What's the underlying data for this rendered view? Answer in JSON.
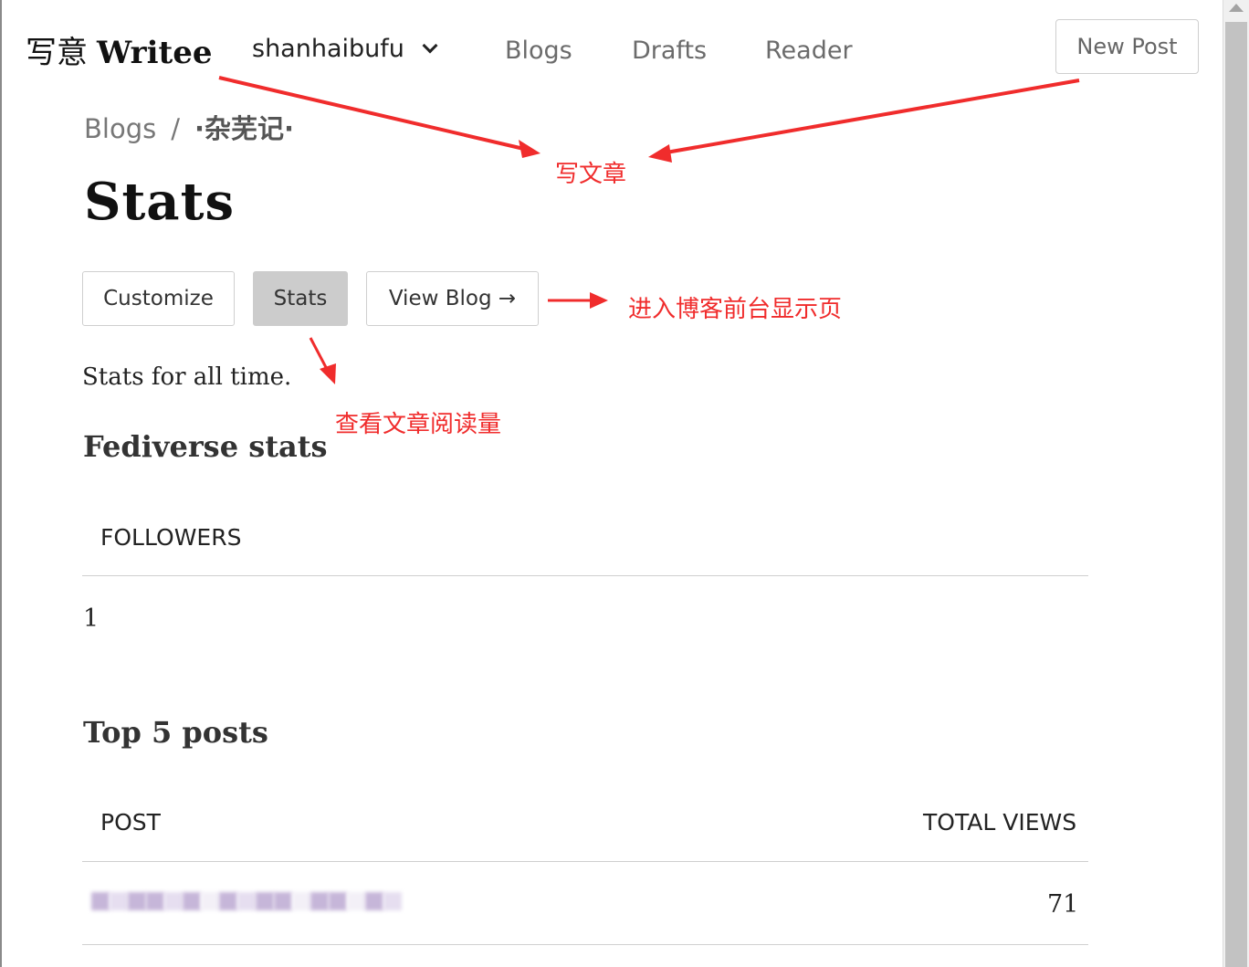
{
  "header": {
    "logo_cn": "写意",
    "logo_en": "Writee",
    "blog_name": "shanhaibufu",
    "nav": [
      "Blogs",
      "Drafts",
      "Reader"
    ],
    "new_post": "New Post"
  },
  "breadcrumb": {
    "root": "Blogs",
    "separator": "/",
    "current": "·杂芜记·"
  },
  "page_title": "Stats",
  "tabs": [
    "Customize",
    "Stats",
    "View Blog →"
  ],
  "active_tab": "Stats",
  "subtitle": "Stats for all time.",
  "fediverse": {
    "heading": "Fediverse stats",
    "column": "FOLLOWERS",
    "value": "1"
  },
  "top_posts": {
    "heading": "Top 5 posts",
    "columns": [
      "POST",
      "TOTAL VIEWS"
    ],
    "rows": [
      {
        "post": "",
        "views": "71"
      }
    ]
  },
  "annotations": {
    "write_post": "写文章",
    "front_page": "进入博客前台显示页",
    "view_stats": "查看文章阅读量"
  },
  "colors": {
    "annotation": "#f02c2c",
    "active_tab_bg": "#cccccc"
  }
}
